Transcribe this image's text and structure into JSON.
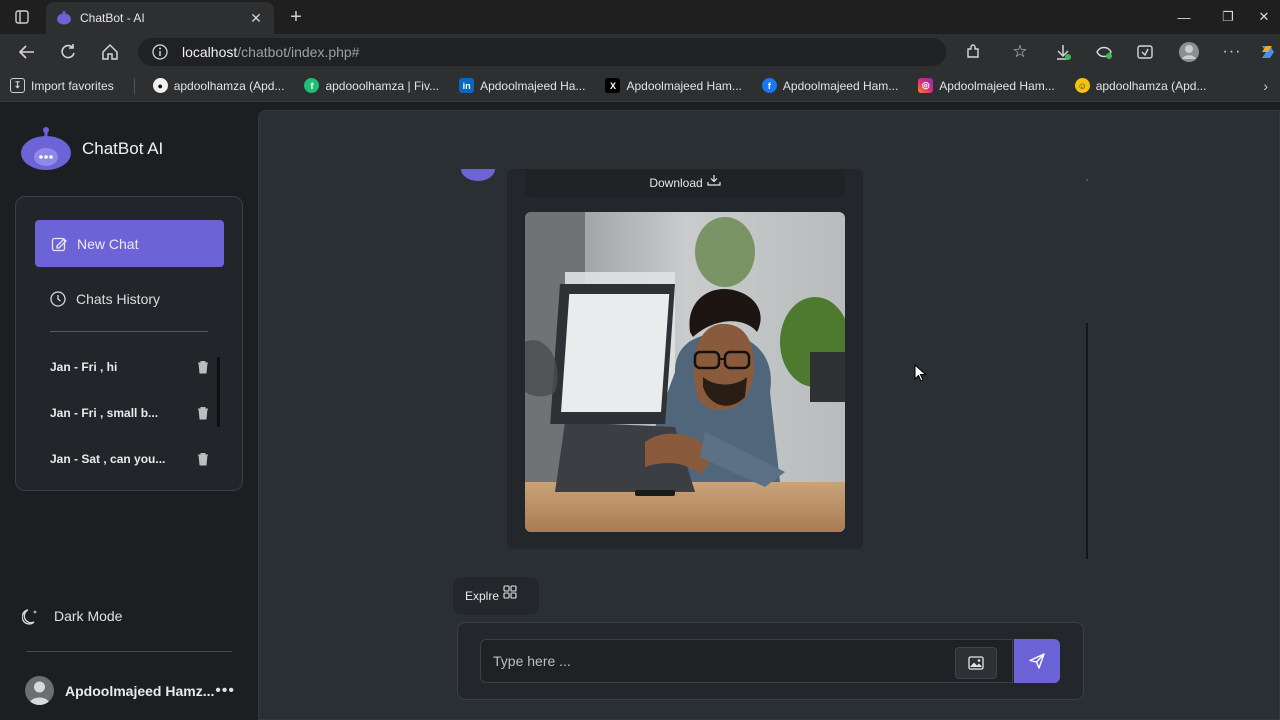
{
  "browser": {
    "tab_title": "ChatBot - AI",
    "url_host": "localhost",
    "url_path": "/chatbot/index.php#",
    "bookmarks": [
      {
        "label": "Import favorites",
        "icon": "import-icon"
      },
      {
        "label": "apdoolhamza (Apd...",
        "icon": "github-icon"
      },
      {
        "label": "apdooolhamza | Fiv...",
        "icon": "fiverr-icon"
      },
      {
        "label": "Apdoolmajeed Ha...",
        "icon": "linkedin-icon"
      },
      {
        "label": "Apdoolmajeed Ham...",
        "icon": "x-icon"
      },
      {
        "label": "Apdoolmajeed Ham...",
        "icon": "facebook-icon"
      },
      {
        "label": "Apdoolmajeed Ham...",
        "icon": "instagram-icon"
      },
      {
        "label": "apdoolhamza (Apd...",
        "icon": "bot-icon"
      }
    ]
  },
  "sidebar": {
    "brand": "ChatBot AI",
    "new_chat": "New Chat",
    "history_title": "Chats History",
    "history": [
      {
        "label": "Jan - Fri , hi"
      },
      {
        "label": "Jan - Fri , small b..."
      },
      {
        "label": "Jan - Sat , can you..."
      }
    ],
    "dark_mode": "Dark Mode",
    "user_name": "Apdoolmajeed Hamz..."
  },
  "chat": {
    "download_label": "Download",
    "explore_label": "Explre",
    "input_placeholder": "Type here ..."
  },
  "colors": {
    "accent": "#6c63d6",
    "background": "#1c1f22",
    "panel": "#2a2f33"
  }
}
